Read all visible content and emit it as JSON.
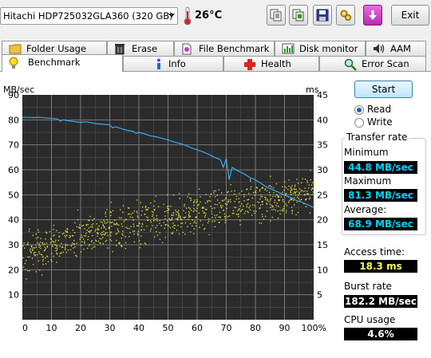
{
  "toolbar": {
    "drive": "Hitachi HDP725032GLA360 (320 GB)",
    "temperature": "26°C",
    "exit_label": "Exit",
    "buttons": [
      {
        "icon": "copy-text-icon"
      },
      {
        "icon": "copy-screenshot-icon"
      },
      {
        "icon": "save-icon"
      },
      {
        "icon": "options-icon"
      },
      {
        "icon": "minimize-to-tray-icon"
      }
    ]
  },
  "tabs": {
    "row1": [
      {
        "label": "Folder Usage",
        "icon": "folder-icon"
      },
      {
        "label": "Erase",
        "icon": "trash-icon"
      },
      {
        "label": "File Benchmark",
        "icon": "file-benchmark-icon"
      },
      {
        "label": "Disk monitor",
        "icon": "disk-monitor-icon"
      },
      {
        "label": "AAM",
        "icon": "speaker-icon"
      }
    ],
    "row2": [
      {
        "label": "Benchmark",
        "icon": "bulb-icon",
        "active": true
      },
      {
        "label": "Info",
        "icon": "info-icon"
      },
      {
        "label": "Health",
        "icon": "health-cross-icon"
      },
      {
        "label": "Error Scan",
        "icon": "magnifier-icon"
      }
    ]
  },
  "controls": {
    "start_label": "Start",
    "read_label": "Read",
    "write_label": "Write",
    "mode_selected": "Read"
  },
  "results": {
    "transfer_rate_title": "Transfer rate",
    "minimum_label": "Minimum",
    "minimum_value": "44.8 MB/sec",
    "maximum_label": "Maximum",
    "maximum_value": "81.3 MB/sec",
    "average_label": "Average:",
    "average_value": "68.9 MB/sec",
    "access_time_label": "Access time:",
    "access_time_value": "18.3 ms",
    "burst_rate_label": "Burst rate",
    "burst_rate_value": "182.2 MB/sec",
    "cpu_usage_label": "CPU usage",
    "cpu_usage_value": "4.6%"
  },
  "colors": {
    "graph_bg": "#2b2b2b",
    "grid": "#7a7a7a",
    "transfer_line": "#3aa9f0",
    "access_dots": "#e8e83a",
    "accent_cyan": "#00d2ff",
    "accent_yellow": "#ffff3c"
  },
  "chart_data": {
    "type": "line",
    "left_axis_label": "MB/sec",
    "right_axis_label": "ms",
    "x_range": [
      0,
      100
    ],
    "y_range": [
      0,
      90
    ],
    "y2_range": [
      0,
      45
    ],
    "x_ticks": [
      "0",
      "10",
      "20",
      "30",
      "40",
      "50",
      "60",
      "70",
      "80",
      "90",
      "100%"
    ],
    "y_ticks": [
      "10",
      "20",
      "30",
      "40",
      "50",
      "60",
      "70",
      "80",
      "90"
    ],
    "y2_ticks": [
      "5",
      "10",
      "15",
      "20",
      "25",
      "30",
      "35",
      "40",
      "45"
    ],
    "grid": true,
    "transfer_rate_series": {
      "x": [
        0,
        2,
        4,
        6,
        8,
        10,
        12,
        13,
        14,
        16,
        18,
        20,
        22,
        24,
        26,
        28,
        30,
        31,
        32,
        34,
        36,
        38,
        39,
        40,
        42,
        44,
        46,
        48,
        50,
        52,
        54,
        56,
        58,
        60,
        62,
        64,
        66,
        68,
        69,
        70,
        71,
        72,
        74,
        76,
        78,
        80,
        82,
        84,
        86,
        88,
        90,
        92,
        94,
        96,
        98,
        100
      ],
      "y": [
        81,
        81,
        80.9,
        81,
        80.8,
        80.6,
        80.4,
        79.5,
        80,
        79.6,
        79.3,
        79,
        79.2,
        78.8,
        78.4,
        78.2,
        78,
        76.8,
        77.2,
        76.5,
        75.8,
        75.4,
        74.6,
        75,
        74.4,
        73.6,
        73.2,
        72.6,
        72,
        71.2,
        70.6,
        69.8,
        68.8,
        68,
        67.2,
        66.2,
        65,
        64,
        61,
        64.5,
        56,
        61,
        59.5,
        58.5,
        57,
        56,
        54.5,
        53,
        52,
        51,
        49.8,
        49,
        47.8,
        47,
        46,
        45
      ]
    },
    "access_time_series": {
      "note_units": "ms",
      "trend_x": [
        0,
        10,
        20,
        30,
        40,
        50,
        60,
        70,
        80,
        90,
        100
      ],
      "trend_y": [
        12,
        15,
        17,
        18.5,
        19.5,
        20.5,
        21.5,
        22.5,
        23.5,
        24.5,
        25.5
      ],
      "spread_ms": 6,
      "count": 900
    }
  }
}
